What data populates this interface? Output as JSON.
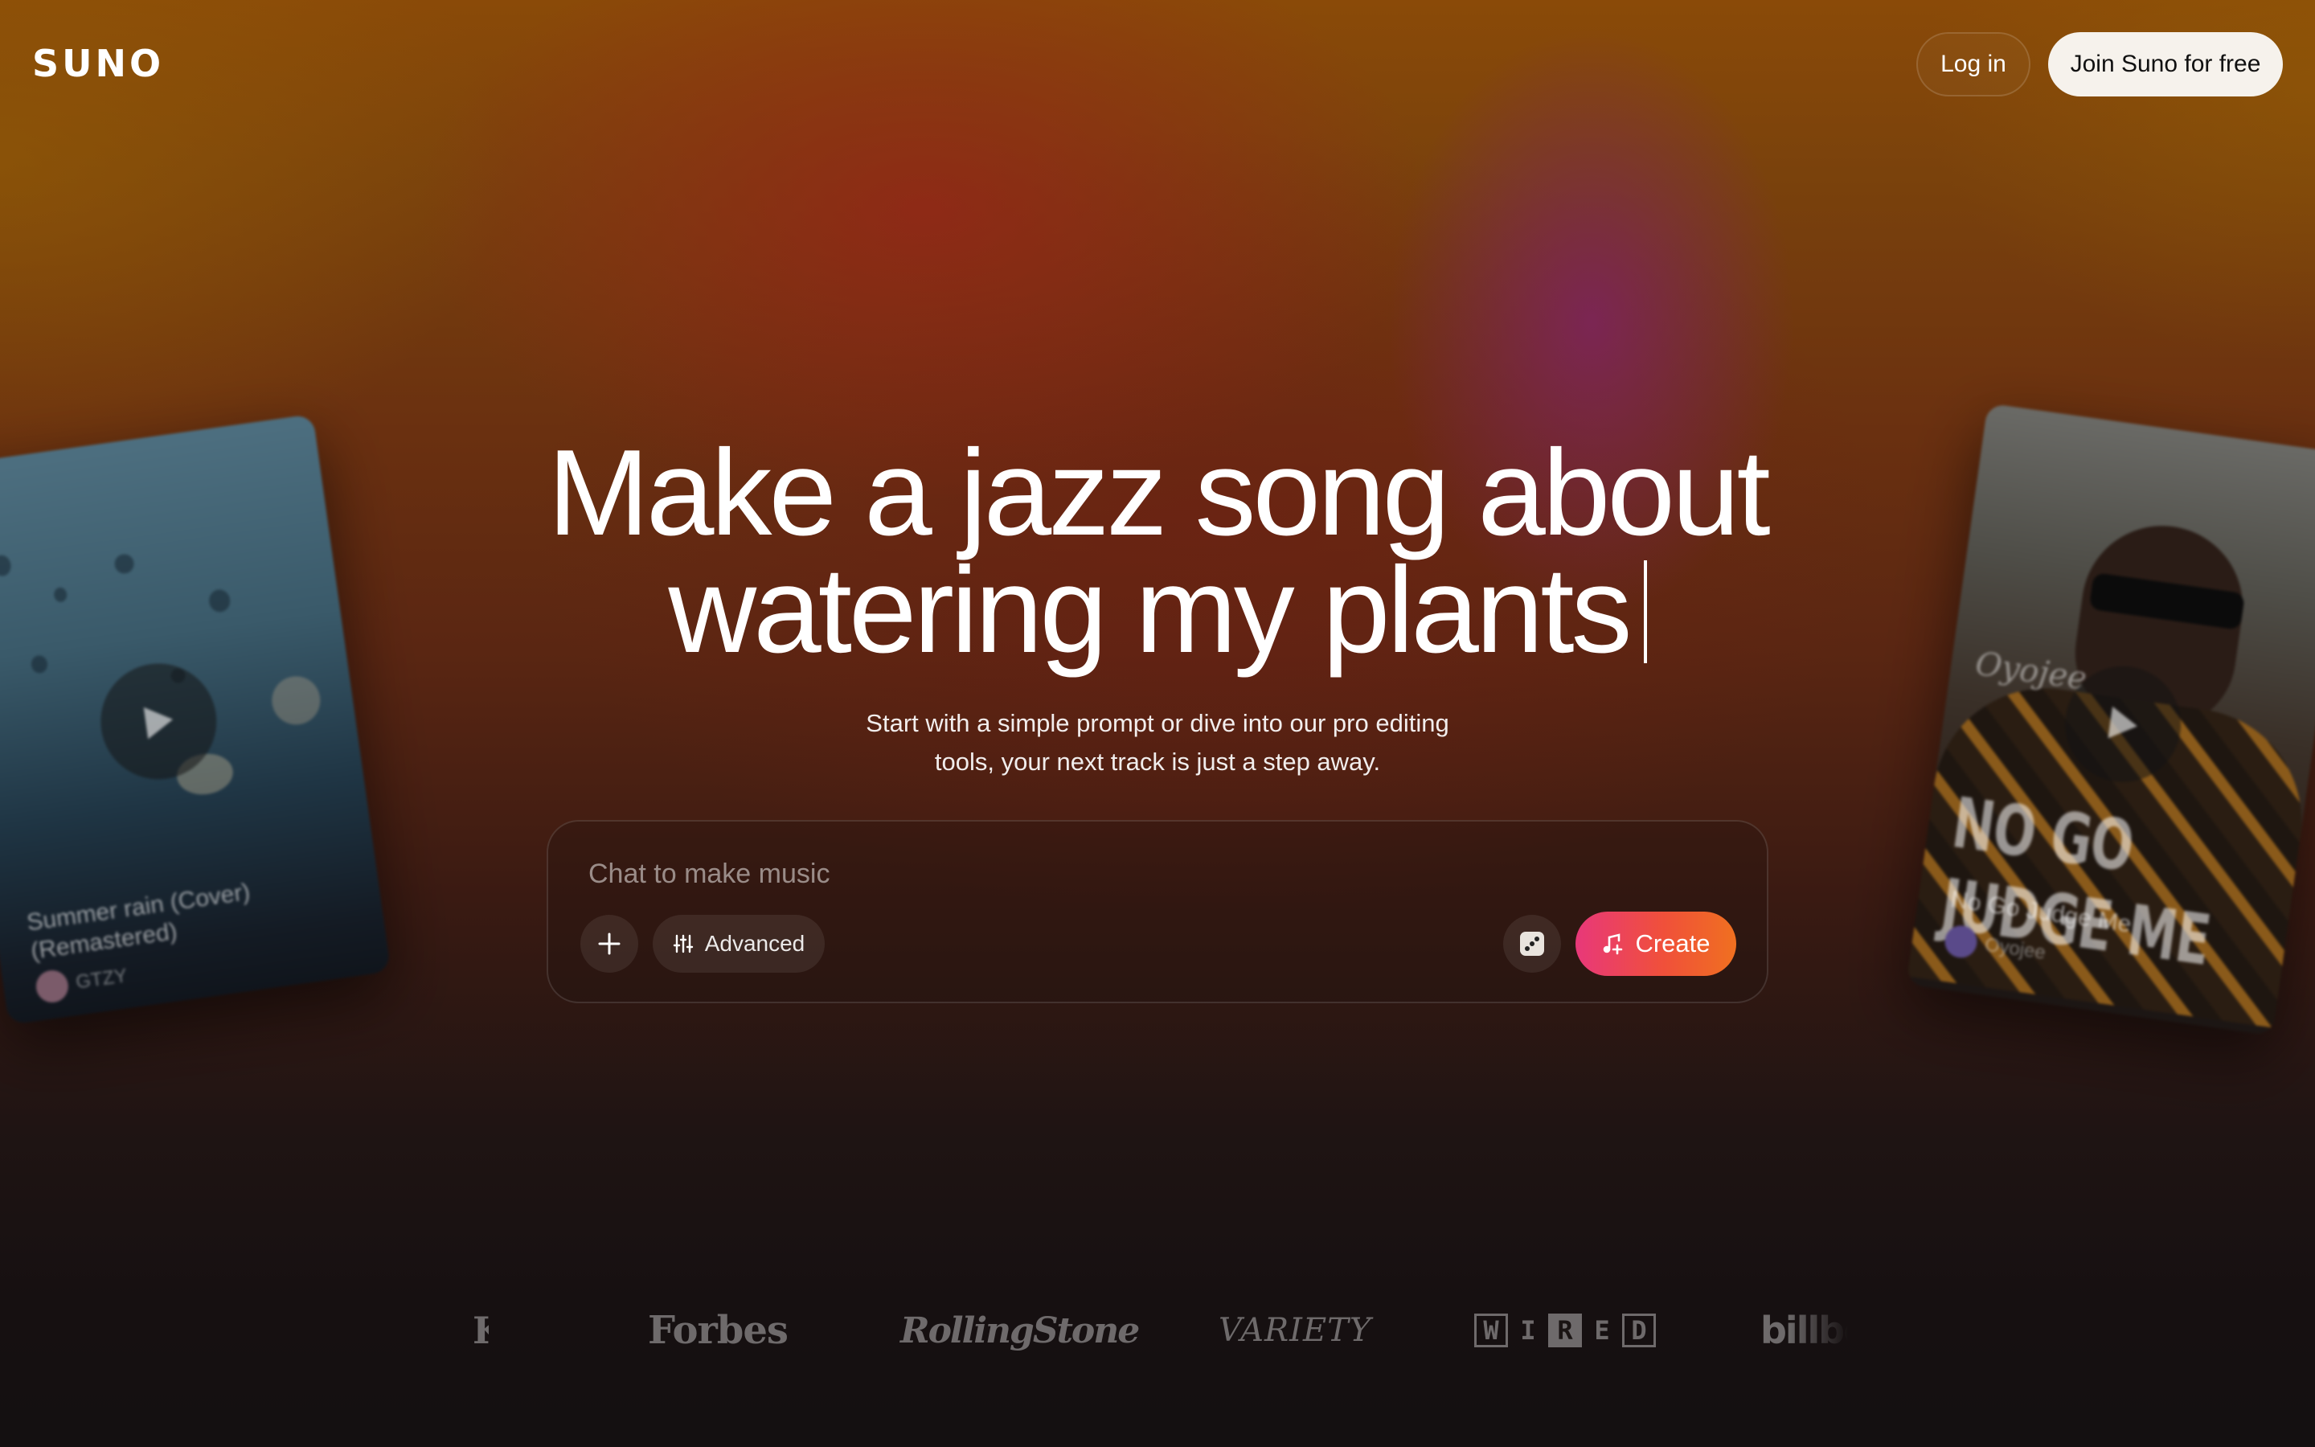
{
  "header": {
    "logo": "SUNO",
    "login_label": "Log in",
    "join_label": "Join Suno for free"
  },
  "hero": {
    "headline_line1": "Make a jazz song about",
    "headline_line2": "watering my plants",
    "subtitle_line1": "Start with a simple prompt or dive into our pro editing",
    "subtitle_line2": "tools, your next track is just a step away."
  },
  "chat": {
    "placeholder": "Chat to make music",
    "advanced_label": "Advanced",
    "create_label": "Create",
    "icons": [
      "plus-icon",
      "sliders-icon",
      "dice-icon",
      "music-note-icon"
    ]
  },
  "cards": {
    "left": {
      "title_line1": "Summer rain (Cover)",
      "title_line2": "(Remastered)",
      "artist": "GTZY"
    },
    "right": {
      "art_script": "Oyojee",
      "art_title": "NO GO JUDGE ME",
      "title": "No Go Judge Me",
      "artist": "Oyojee"
    }
  },
  "press": {
    "logos": [
      "Forbes",
      "RollingStone",
      "VARIETY",
      "WIRED",
      "billboard"
    ],
    "wired_letters": [
      "W",
      "I",
      "R",
      "E",
      "D"
    ]
  },
  "colors": {
    "create_gradient_start": "#e8387a",
    "create_gradient_end": "#f07020",
    "join_button_bg": "#f6f2ec"
  }
}
